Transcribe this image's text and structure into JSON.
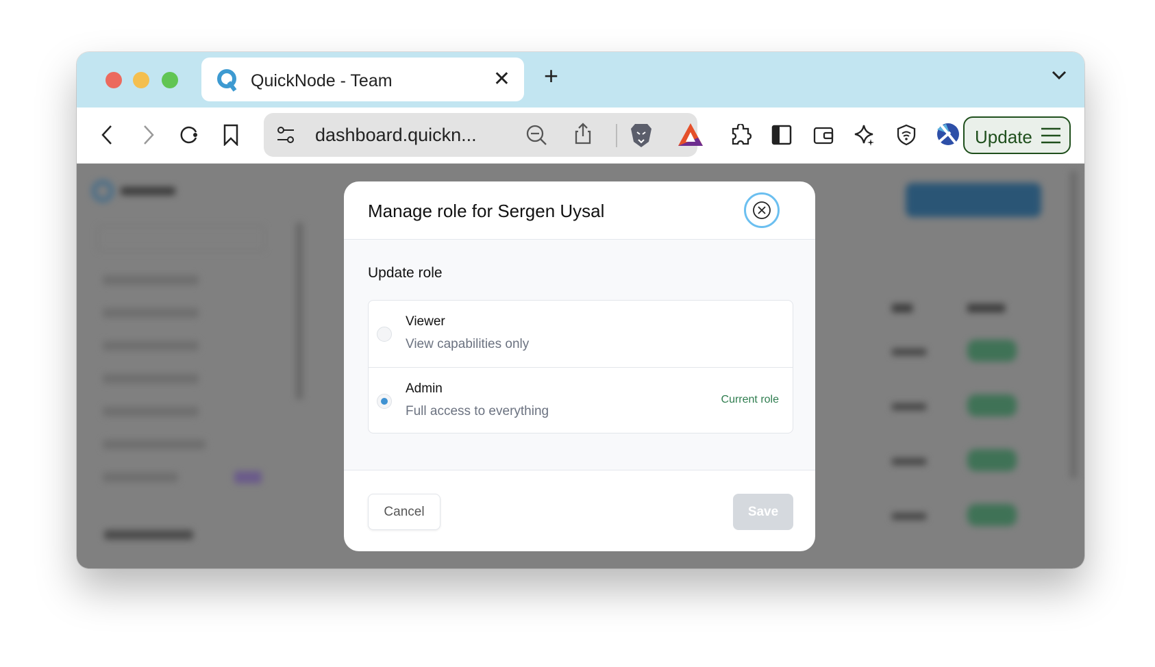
{
  "browser": {
    "tab_title": "QuickNode - Team",
    "url": "dashboard.quickn...",
    "update_label": "Update",
    "colors": {
      "tabbar": "#c2e5f1",
      "update": "#1f4f1c"
    }
  },
  "modal": {
    "title": "Manage role for Sergen Uysal",
    "section_label": "Update role",
    "options": [
      {
        "name": "Viewer",
        "description": "View capabilities only",
        "selected": false,
        "badge": ""
      },
      {
        "name": "Admin",
        "description": "Full access to everything",
        "selected": true,
        "badge": "Current role"
      }
    ],
    "cancel_label": "Cancel",
    "save_label": "Save",
    "save_enabled": false
  }
}
